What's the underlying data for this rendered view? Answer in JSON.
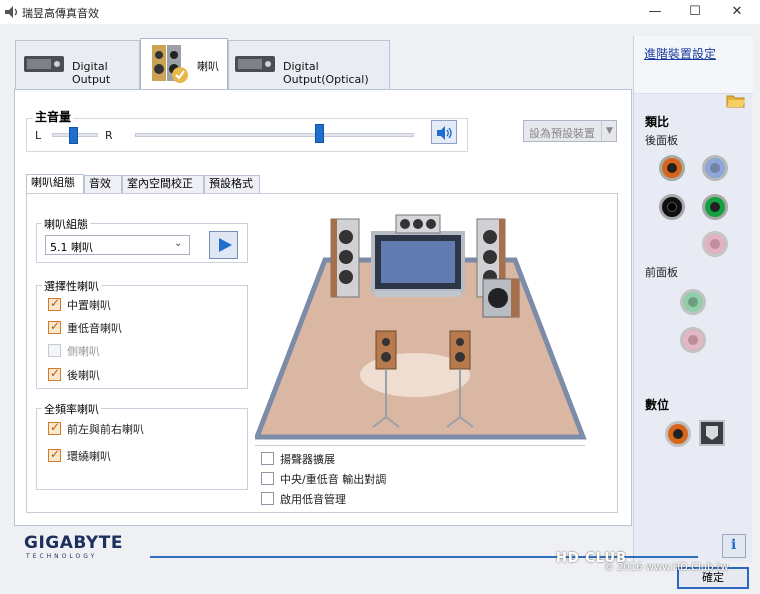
{
  "window": {
    "title": "瑞昱高傳真音效"
  },
  "device_tabs": [
    {
      "label": "Digital Output"
    },
    {
      "label": "喇叭"
    },
    {
      "label": "Digital Output(Optical)"
    }
  ],
  "sidebar": {
    "advanced_link": "進階裝置設定",
    "analog_title": "類比",
    "rear_panel": "後面板",
    "front_panel": "前面板",
    "digital_title": "數位"
  },
  "main_volume": {
    "title": "主音量",
    "left": "L",
    "right": "R",
    "balance_value": 0.5,
    "volume_value": 0.66,
    "set_default_label": "設為預設裝置"
  },
  "sub_tabs": [
    {
      "label": "喇叭組態"
    },
    {
      "label": "音效"
    },
    {
      "label": "室內空間校正"
    },
    {
      "label": "預設格式"
    }
  ],
  "speaker_config": {
    "group_title": "喇叭組態",
    "selected": "5.1 喇叭"
  },
  "optional_speakers": {
    "title": "選擇性喇叭",
    "items": [
      {
        "label": "中置喇叭",
        "checked": true,
        "enabled": true
      },
      {
        "label": "重低音喇叭",
        "checked": true,
        "enabled": true
      },
      {
        "label": "側喇叭",
        "checked": false,
        "enabled": false
      },
      {
        "label": "後喇叭",
        "checked": true,
        "enabled": true
      }
    ]
  },
  "fullrange": {
    "title": "全頻率喇叭",
    "items": [
      {
        "label": "前左與前右喇叭",
        "checked": true
      },
      {
        "label": "環繞喇叭",
        "checked": true
      }
    ]
  },
  "bottom_options": [
    {
      "label": "揚聲器擴展",
      "checked": false
    },
    {
      "label": "中央/重低音 輸出對調",
      "checked": false
    },
    {
      "label": "啟用低音管理",
      "checked": false
    }
  ],
  "footer": {
    "brand": "GIGABYTE",
    "brand_sub": "TECHNOLOGY",
    "ok_label": "確定",
    "watermark_logo": "HD CLUB",
    "watermark": "© 2016  www.HD.Club.tw"
  },
  "colors": {
    "accent": "#1f6fcf",
    "jack_orange": "#d8651c",
    "jack_blue": "#6f8fcf",
    "jack_black": "#111111",
    "jack_green": "#13a040",
    "jack_pink": "#e0a0b0"
  }
}
